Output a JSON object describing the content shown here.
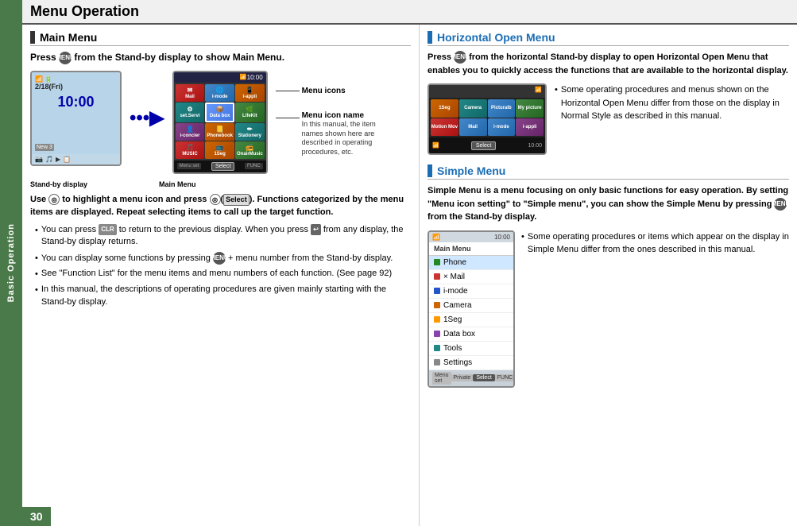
{
  "page": {
    "title": "Menu Operation",
    "page_number": "30",
    "sidebar_label": "Basic Operation"
  },
  "main_menu_section": {
    "header": "Main Menu",
    "press_instruction": "Press  from the Stand-by display to show Main Menu.",
    "stand_by_label": "Stand-by display",
    "main_menu_label": "Main Menu",
    "menu_icons_annotation": "Menu icons",
    "menu_icon_name_label": "Menu icon name",
    "menu_icon_name_desc": "In this manual, the item names shown here are described in operating procedures, etc.",
    "body_text": "Use  to highlight a menu icon and press  (Select). Functions categorized by the menu items are displayed. Repeat selecting items to call up the target function.",
    "bullets": [
      "You can press  to return to the previous display. When you press  from any display, the Stand-by display returns.",
      "You can display some functions by pressing  + menu number from the Stand-by display.",
      "See \"Function List\" for the menu items and menu numbers of each function. (See page 92)",
      "In this manual, the descriptions of operating procedures are given mainly starting with the Stand-by display."
    ]
  },
  "horizontal_section": {
    "header": "Horizontal Open Menu",
    "body_text": "Press  from the horizontal Stand-by display to open Horizontal Open Menu that enables you to quickly access the functions that are available to the horizontal display.",
    "bullet": "Some operating procedures and menus shown on the Horizontal Open Menu differ from those on the display in Normal Style as described in this manual.",
    "select_label": "Select"
  },
  "simple_menu_section": {
    "header": "Simple Menu",
    "body_text": "Simple Menu is a menu focusing on only basic functions for easy operation. By setting \"Menu icon setting\" to \"Simple menu\", you can show the Simple Menu by pressing  from the Stand-by display.",
    "bullet": "Some operating procedures or items which appear on the display in Simple Menu differ from the ones described in this manual.",
    "menu_items": [
      "Phone",
      "Mail",
      "i-mode",
      "Camera",
      "1Seg",
      "Data box",
      "Tools",
      "Settings"
    ],
    "menu_top_label": "Main Menu",
    "bottom_labels": [
      "Menu set",
      "Private",
      "Select",
      "FUNC"
    ]
  },
  "standby_phone": {
    "date": "2/18(Fri)",
    "time": "10:00",
    "signal_icon": "📶"
  },
  "main_menu_phone": {
    "time": "10:00",
    "cells": [
      {
        "label": "Mail",
        "color": "red"
      },
      {
        "label": "i-mode",
        "color": "blue"
      },
      {
        "label": "i-appli",
        "color": "orange"
      },
      {
        "label": "set.Servi",
        "color": "teal"
      },
      {
        "label": "Data box",
        "color": "highlight-box"
      },
      {
        "label": "LifeKit",
        "color": "green"
      },
      {
        "label": "i-concier",
        "color": "purple"
      },
      {
        "label": "Phonebook",
        "color": "orange"
      },
      {
        "label": "Stationery",
        "color": "teal"
      },
      {
        "label": "MUSIC",
        "color": "red"
      },
      {
        "label": "1Seg",
        "color": "orange"
      },
      {
        "label": "OnairMusic",
        "color": "green"
      },
      {
        "label": "Menu set",
        "color": "dark"
      },
      {
        "label": "Select",
        "color": "select"
      },
      {
        "label": "FUNC",
        "color": "dark"
      }
    ]
  },
  "horizontal_phone": {
    "cells_row1": [
      {
        "label": "1Seg",
        "color": "orange"
      },
      {
        "label": "Camera",
        "color": "teal"
      },
      {
        "label": "Picturalb",
        "color": "blue"
      },
      {
        "label": "My picture",
        "color": "green"
      }
    ],
    "cells_row2": [
      {
        "label": "Motion Mov",
        "color": "red"
      },
      {
        "label": "Mail",
        "color": "blue"
      },
      {
        "label": "i-mode",
        "color": "blue"
      },
      {
        "label": "i-appli",
        "color": "purple"
      }
    ],
    "select_label": "Select",
    "time": "10:00"
  }
}
